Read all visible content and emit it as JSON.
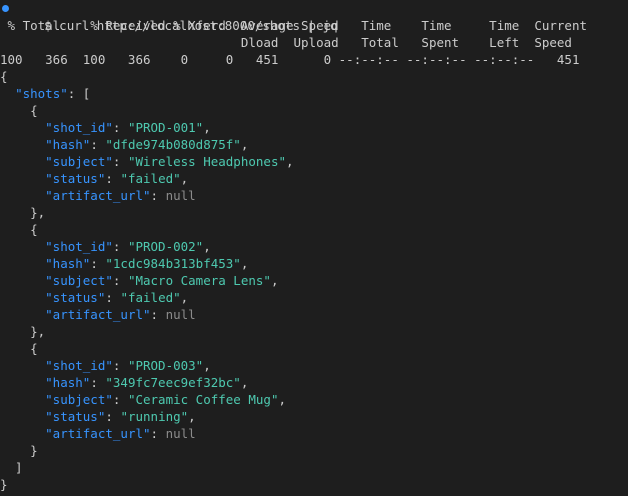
{
  "prompt": {
    "symbol": "$",
    "command": "curl http://localhost:8000/shots | jq"
  },
  "curl_progress": {
    "header_line1": " % Total    % Received % Xferd  Average Speed   Time    Time     Time  Current",
    "header_line2": "                                Dload  Upload   Total   Spent    Left  Speed",
    "stats_line": "100   366  100   366    0     0   451      0 --:--:-- --:--:-- --:--:--   451"
  },
  "json_output": {
    "root_key": "shots",
    "shots": [
      {
        "shot_id": "PROD-001",
        "hash": "dfde974b080d875f",
        "subject": "Wireless Headphones",
        "status": "failed",
        "artifact_url": "null"
      },
      {
        "shot_id": "PROD-002",
        "hash": "1cdc984b313bf453",
        "subject": "Macro Camera Lens",
        "status": "failed",
        "artifact_url": "null"
      },
      {
        "shot_id": "PROD-003",
        "hash": "349fc7eec9ef32bc",
        "subject": "Ceramic Coffee Mug",
        "status": "running",
        "artifact_url": "null"
      }
    ]
  },
  "colors": {
    "background": "#1e1e1e",
    "key": "#3794ff",
    "string": "#4ec9b0",
    "null": "#8b8b8b",
    "text": "#cccccc",
    "prompt_dot": "#3794ff"
  }
}
